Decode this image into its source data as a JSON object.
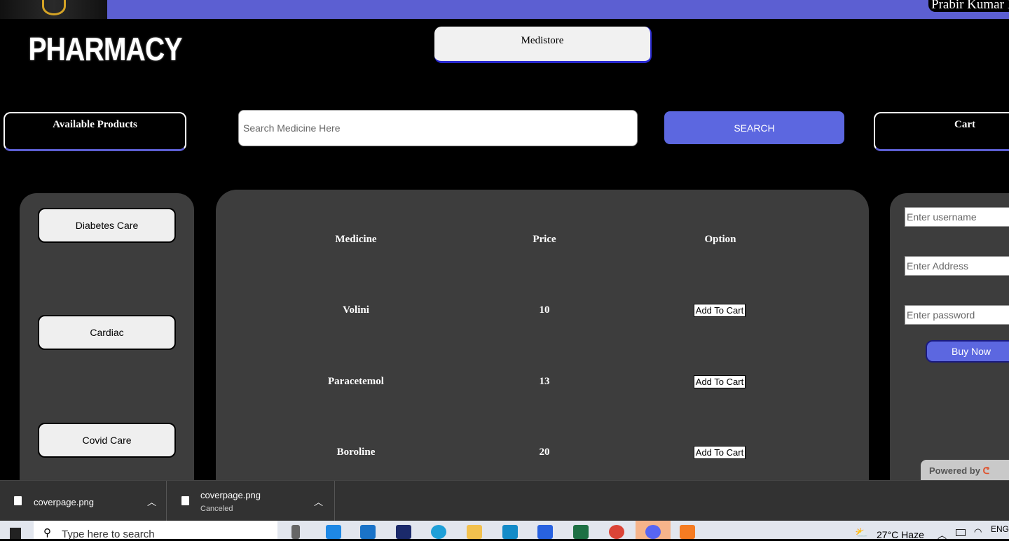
{
  "header": {
    "user_name": "Prabir Kumar I",
    "logo_text": "PHARMACY",
    "store_button": "Medistore"
  },
  "nav": {
    "available_products": "Available Products",
    "search_placeholder": "Search Medicine Here",
    "search_button": "SEARCH",
    "cart": "Cart"
  },
  "categories": [
    "Diabetes Care",
    "Cardiac",
    "Covid Care"
  ],
  "table": {
    "headers": [
      "Medicine",
      "Price",
      "Option"
    ],
    "rows": [
      {
        "medicine": "Volini",
        "price": "10",
        "option": "Add To Cart"
      },
      {
        "medicine": "Paracetemol",
        "price": "13",
        "option": "Add To Cart"
      },
      {
        "medicine": "Boroline",
        "price": "20",
        "option": "Add To Cart"
      }
    ]
  },
  "checkout": {
    "username_placeholder": "Enter username",
    "address_placeholder": "Enter Address",
    "password_placeholder": "Enter password",
    "buy_button": "Buy Now",
    "powered_by": "Powered by"
  },
  "downloads": [
    {
      "name": "coverpage.png",
      "status": ""
    },
    {
      "name": "coverpage.png",
      "status": "Canceled"
    }
  ],
  "taskbar": {
    "search_placeholder": "Type here to search",
    "weather": "27°C  Haze",
    "language": "ENG"
  },
  "colors": {
    "accent": "#5c5fd2",
    "panel": "#3d3d3d"
  }
}
